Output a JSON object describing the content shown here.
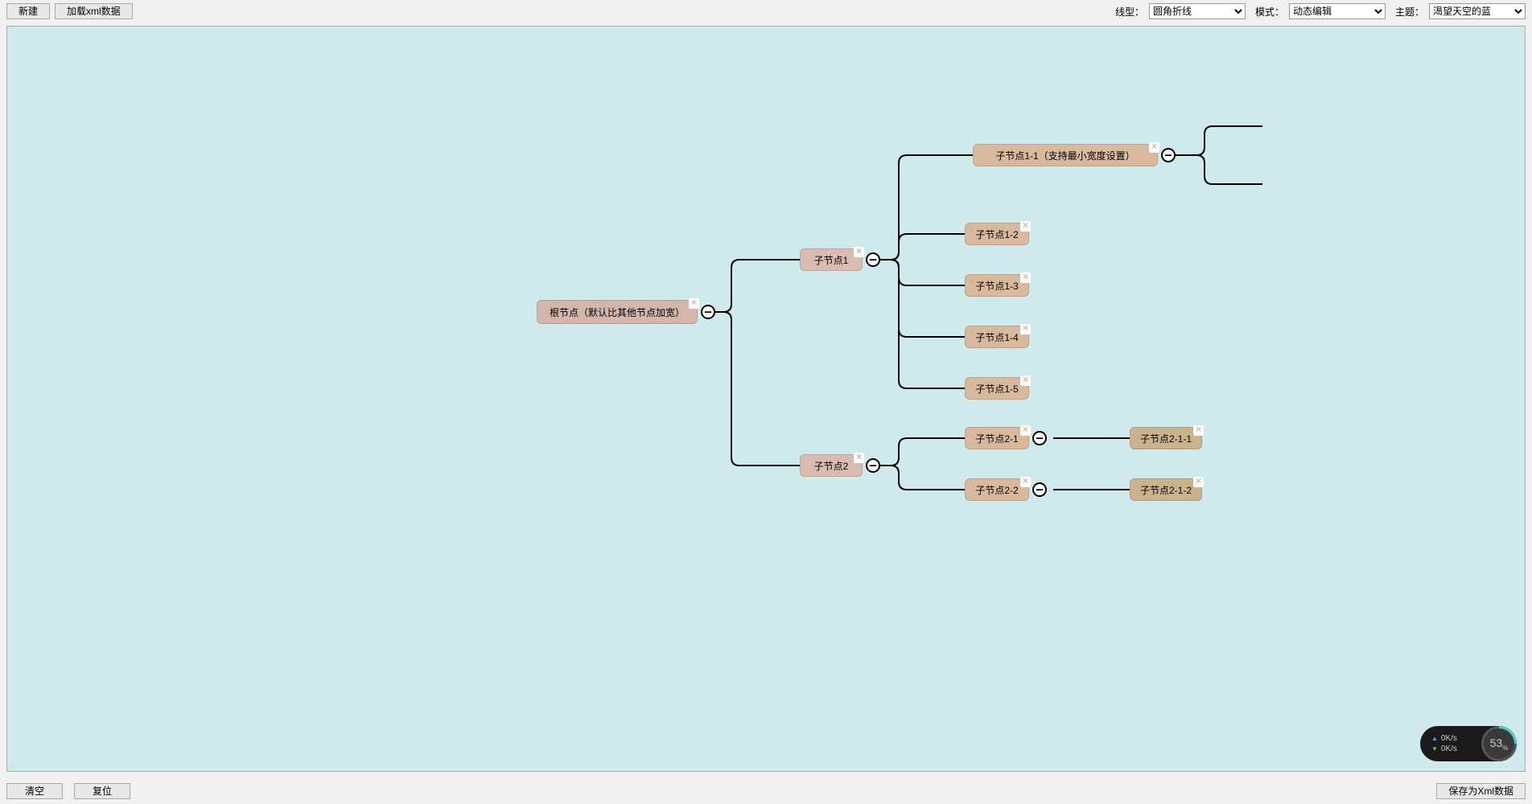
{
  "toolbar": {
    "new_label": "新建",
    "load_label": "加载xml数据",
    "line_type_label": "线型：",
    "line_type_value": "圆角折线",
    "mode_label": "模式：",
    "mode_value": "动态编辑",
    "theme_label": "主题：",
    "theme_value": "渴望天空的蓝"
  },
  "bottom": {
    "clear_label": "清空",
    "reset_label": "复位",
    "save_label": "保存为Xml数据"
  },
  "nodes": {
    "root": "根节点（默认比其他节点加宽）",
    "n1": "子节点1",
    "n2": "子节点2",
    "n1_1": "子节点1-1（支持最小宽度设置）",
    "n1_2": "子节点1-2",
    "n1_3": "子节点1-3",
    "n1_4": "子节点1-4",
    "n1_5": "子节点1-5",
    "n2_1": "子节点2-1",
    "n2_2": "子节点2-2",
    "n2_1_1": "子节点2-1-1",
    "n2_1_2": "子节点2-1-2"
  },
  "widget": {
    "up": "0K/s",
    "down": "0K/s",
    "pct": "53"
  },
  "toggle_minus": "–",
  "close_x": "×"
}
